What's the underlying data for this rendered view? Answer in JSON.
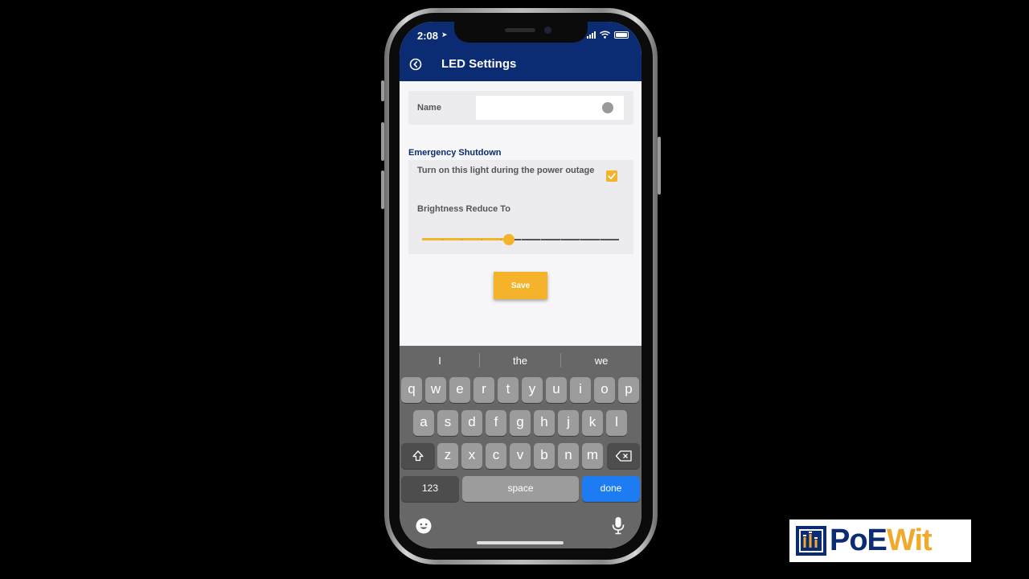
{
  "status_bar": {
    "time": "2:08"
  },
  "header": {
    "title": "LED Settings",
    "back_icon": "back-arrow-circle-icon"
  },
  "name_field": {
    "label": "Name",
    "value": ""
  },
  "emergency": {
    "section_title": "Emergency Shutdown",
    "power_outage_label": "Turn on this light during the power outage",
    "power_outage_checked": true,
    "brightness_label": "Brightness Reduce To",
    "brightness_level": 0.44,
    "slider_steps": 10
  },
  "save_label": "Save",
  "keyboard": {
    "suggestions": [
      "I",
      "the",
      "we"
    ],
    "row1": [
      "q",
      "w",
      "e",
      "r",
      "t",
      "y",
      "u",
      "i",
      "o",
      "p"
    ],
    "row2": [
      "a",
      "s",
      "d",
      "f",
      "g",
      "h",
      "j",
      "k",
      "l"
    ],
    "row3": [
      "z",
      "x",
      "c",
      "v",
      "b",
      "n",
      "m"
    ],
    "numbers_label": "123",
    "space_label": "space",
    "done_label": "done"
  },
  "brand": {
    "part1": "PoE",
    "part2": "Wit"
  },
  "colors": {
    "header": "#0b2b73",
    "accent": "#f4b32a",
    "done": "#1e7cf2",
    "keyboard": "#676767"
  }
}
